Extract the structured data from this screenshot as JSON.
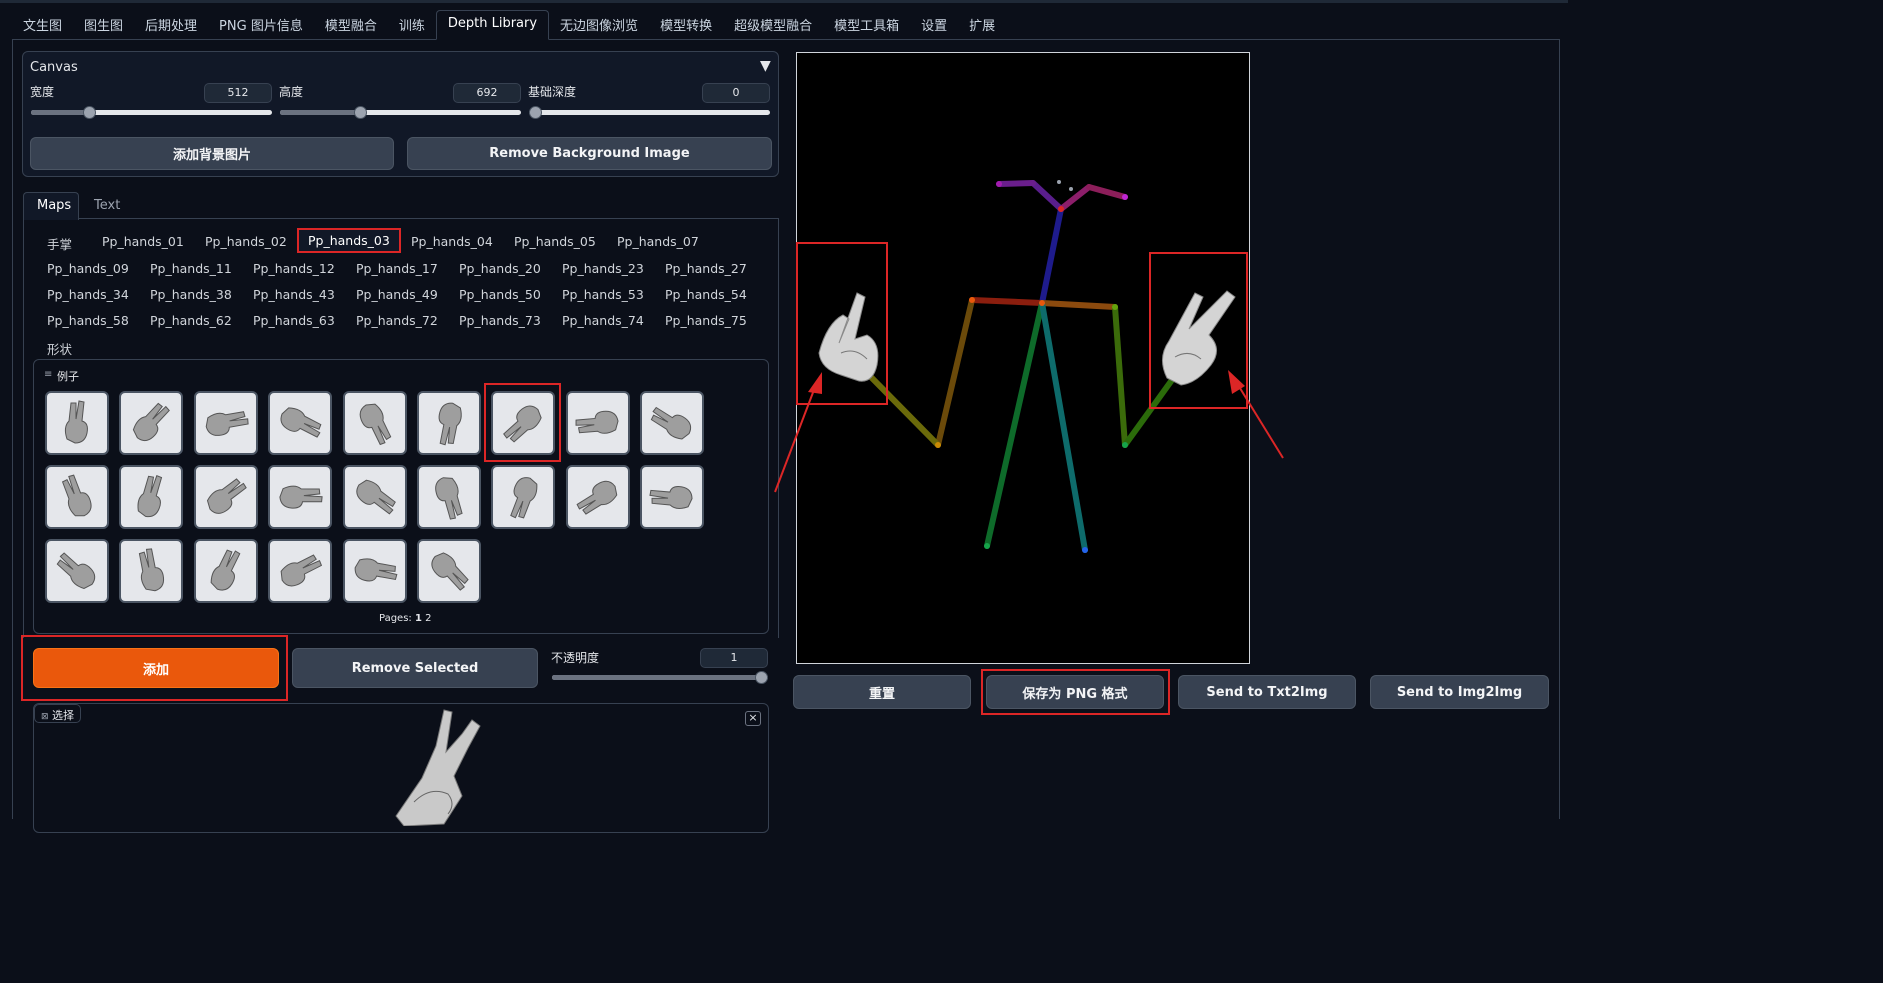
{
  "tabs": [
    "文生图",
    "图生图",
    "后期处理",
    "PNG 图片信息",
    "模型融合",
    "训练",
    "Depth Library",
    "无边图像浏览",
    "模型转换",
    "超级模型融合",
    "模型工具箱",
    "设置",
    "扩展"
  ],
  "canvas_panel": {
    "title": "Canvas",
    "collapse_icon": "▼",
    "width_label": "宽度",
    "width_value": "512",
    "width_fraction": 0.24,
    "height_label": "高度",
    "height_value": "692",
    "height_fraction": 0.33,
    "depth_label": "基础深度",
    "depth_value": "0",
    "depth_fraction": 0.0,
    "add_bg_label": "添加背景图片",
    "remove_bg_label": "Remove Background Image"
  },
  "maps_tabs": {
    "maps": "Maps",
    "text": "Text"
  },
  "hands_section": {
    "category_label": "手掌",
    "items": [
      "Pp_hands_01",
      "Pp_hands_02",
      "Pp_hands_03",
      "Pp_hands_04",
      "Pp_hands_05",
      "Pp_hands_07",
      "Pp_hands_09",
      "Pp_hands_11",
      "Pp_hands_12",
      "Pp_hands_17",
      "Pp_hands_20",
      "Pp_hands_23",
      "Pp_hands_27",
      "Pp_hands_34",
      "Pp_hands_38",
      "Pp_hands_43",
      "Pp_hands_49",
      "Pp_hands_50",
      "Pp_hands_53",
      "Pp_hands_54",
      "Pp_hands_58",
      "Pp_hands_62",
      "Pp_hands_63",
      "Pp_hands_72",
      "Pp_hands_73",
      "Pp_hands_74",
      "Pp_hands_75"
    ],
    "selected": "Pp_hands_03",
    "shapes_label": "形状"
  },
  "examples": {
    "label": "例子",
    "pages_label": "Pages:",
    "pages": [
      "1",
      "2"
    ]
  },
  "actions": {
    "add_label": "添加",
    "remove_selected_label": "Remove Selected",
    "opacity_label": "不透明度",
    "opacity_value": "1",
    "opacity_fraction": 1.0
  },
  "selection": {
    "label": "选择",
    "close": "×"
  },
  "right_buttons": {
    "reset": "重置",
    "save_png": "保存为 PNG 格式",
    "send_txt2img": "Send to Txt2Img",
    "send_img2img": "Send to Img2Img"
  },
  "colors": {
    "accent": "#ea580c",
    "highlight": "#dc2626",
    "bg": "#0b0f19"
  }
}
